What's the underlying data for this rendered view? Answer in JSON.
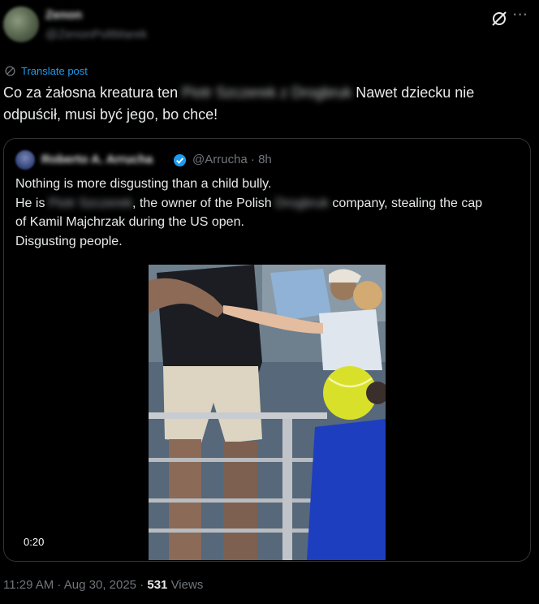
{
  "author": {
    "name": "Zenon",
    "handle": "@ZenonPoltMarek",
    "avatar_icon": "profile-avatar"
  },
  "actions": {
    "grok_icon": "grok-slash-icon",
    "more_label": "···"
  },
  "translate": {
    "label": "Translate post",
    "icon": "globe-icon"
  },
  "post": {
    "text_before": "Co za żałosna kreatura ten ",
    "blurred_name": "Piotr Szczerek z Drogbruk",
    "text_after": " Nawet dziecku nie odpuścił, musi być jego, bo chce!"
  },
  "quote": {
    "name": "Roberto A. Arrucha",
    "handle": "@Arrucha",
    "separator": "·",
    "time": "8h",
    "verified_icon": "verified-badge-icon",
    "line1": "Nothing is more disgusting than a child bully.",
    "line2_a": "He is ",
    "line2_blur1": "Piotr Szczerek",
    "line2_b": ", the owner of the Polish ",
    "line2_blur2": "Drogbruk",
    "line2_c": " company, stealing the cap",
    "line3": "of Kamil Majchrzak during the US open.",
    "line4": "Disgusting people.",
    "video_duration": "0:20"
  },
  "footer": {
    "time": "11:29 AM",
    "separator": " · ",
    "date": "Aug 30, 2025",
    "views_count": "531",
    "views_label": " Views"
  },
  "colors": {
    "background": "#000000",
    "text": "#e7e9ea",
    "muted": "#71767b",
    "accent": "#1d9bf0",
    "border": "#2f3336"
  }
}
